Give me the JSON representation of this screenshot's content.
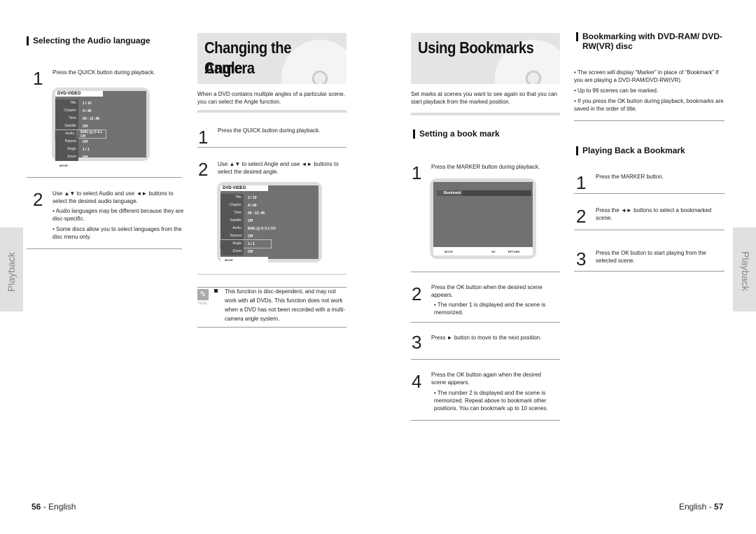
{
  "left_page": {
    "audio_section": {
      "heading": "Selecting the Audio language",
      "steps": [
        {
          "num": "1",
          "text": "Press the QUICK button during playback."
        },
        {
          "num": "2",
          "text": "Use ▲▼ to select Audio and use ◄► buttons to select the desired audio language.",
          "bullets": [
            "• Audio languages may be different because they are disc-specific.",
            "• Some discs allow you to select languages from the disc menu only."
          ]
        }
      ],
      "osd": {
        "header": "DVD-VIDEO",
        "rows": [
          {
            "label": "Title",
            "value": "1 / 10"
          },
          {
            "label": "Chapter",
            "value": "4 / 40"
          },
          {
            "label": "Time",
            "value": "00 : 12 :45"
          },
          {
            "label": "Subtitle",
            "value": "Off"
          },
          {
            "label": "Audio",
            "value": "ENG ▯▯ D 5.1 CH"
          },
          {
            "label": "Repeat",
            "value": "Off"
          },
          {
            "label": "Angle",
            "value": "1 / 1"
          },
          {
            "label": "Zoom",
            "value": "Off"
          }
        ],
        "footer": "MOVE",
        "highlighted_row": "Audio"
      }
    },
    "camera_section": {
      "title": "Changing the Camera Angle",
      "title_line1": "Changing the Camera",
      "title_line2": "Angle",
      "intro": "When a DVD contains multiple angles of a particular scene, you can select the Angle function.",
      "steps": [
        {
          "num": "1",
          "text": "Press the QUICK button during playback."
        },
        {
          "num": "2",
          "text": "Use ▲▼ to select Angle and use ◄► buttons to select the desired angle."
        }
      ],
      "osd": {
        "header": "DVD-VIDEO",
        "rows": [
          {
            "label": "Title",
            "value": "1 / 10"
          },
          {
            "label": "Chapter",
            "value": "4 / 40"
          },
          {
            "label": "Time",
            "value": "00 : 12 :45"
          },
          {
            "label": "Subtitle",
            "value": "Off"
          },
          {
            "label": "Audio",
            "value": "ENG ▯▯ D 5.1 CH"
          },
          {
            "label": "Repeat",
            "value": "Off"
          },
          {
            "label": "Angle",
            "value": "1 / 1"
          },
          {
            "label": "Zoom",
            "value": "Off"
          }
        ],
        "footer": "MOVE",
        "highlighted_row": "Angle"
      },
      "note": {
        "label": "Note",
        "text": "This function is disc-dependent, and may not work with all DVDs. This function does not work when a DVD has not been recorded with a multi-camera angle system."
      }
    },
    "side_tab": "Playback",
    "footer": {
      "page_num": "56",
      "sep": " - ",
      "lang": "English"
    }
  },
  "right_page": {
    "bookmarks_section": {
      "title": "Using Bookmarks",
      "intro": "Set marks at scenes you want to see again so that you can start playback from the marked position.",
      "subheading": "Setting a book mark",
      "steps": [
        {
          "num": "1",
          "text": "Press the MARKER button during playback."
        },
        {
          "num": "2",
          "text": "Press the OK button when the desired scene appears.",
          "bullets": [
            "• The number 1 is displayed and the scene is memorized."
          ]
        },
        {
          "num": "3",
          "text": "Press ► button to move to the next position."
        },
        {
          "num": "4",
          "text": "Press the OK button again when the desired scene appears.",
          "bullets": [
            "• The number 2 is displayed and the scene is memorized. Repeat above to bookmark other positions. You can bookmark up to 10 scenes."
          ]
        }
      ],
      "osd": {
        "bar_label": "Bookmark",
        "slots": [
          "-",
          "-",
          "-",
          "-",
          "-",
          "-",
          "-",
          "-",
          "-",
          "-"
        ],
        "footer": [
          "MOVE",
          "OK",
          "RETURN"
        ]
      }
    },
    "dvdram_section": {
      "heading": "Bookmarking with DVD-RAM/ DVD-RW(VR) disc",
      "bullets": [
        "• The screen will display “Marker” in place of “Bookmark” if you are playing a DVD-RAM/DVD-RW(VR).",
        "• Up to 99 scenes can be marked.",
        "• If you press the OK button during playback, bookmarks are saved in the order of title."
      ]
    },
    "playback_section": {
      "heading": "Playing Back a Bookmark",
      "steps": [
        {
          "num": "1",
          "text": "Press the MARKER button."
        },
        {
          "num": "2",
          "text": "Press the ◄►  buttons to select a bookmarked scene."
        },
        {
          "num": "3",
          "text": "Press the OK button to start playing from the selected scene."
        }
      ]
    },
    "side_tab": "Playback",
    "footer": {
      "lang": "English",
      "sep": " - ",
      "page_num": "57"
    }
  }
}
